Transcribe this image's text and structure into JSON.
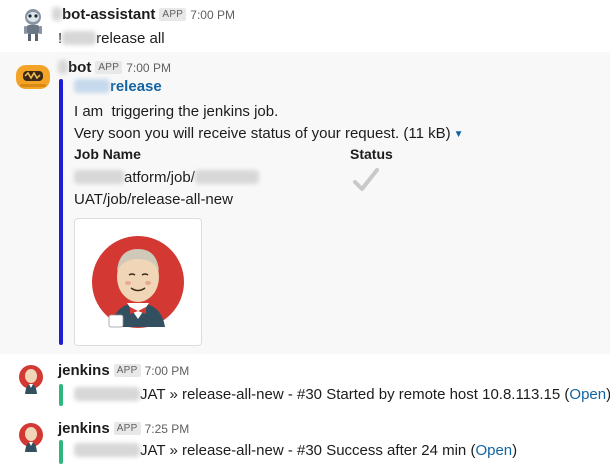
{
  "messages": [
    {
      "sender": "bot-assistant",
      "badge": "APP",
      "time": "7:00 PM",
      "text_prefix": "!",
      "text": "release all"
    },
    {
      "sender": "bot",
      "badge": "APP",
      "time": "7:00 PM",
      "attachment": {
        "title": "release",
        "line1": "I am  triggering the jenkins job.",
        "line2": "Very soon you will receive status of your request.",
        "size": "(11 kB)",
        "col_job": "Job Name",
        "col_status": "Status",
        "job_part1": "atform/job/",
        "job_part2": "UAT/job/release-all-new",
        "status_icon": "check-icon",
        "bar_color": "#1d1dd6"
      }
    },
    {
      "sender": "jenkins",
      "badge": "APP",
      "time": "7:00 PM",
      "text": "JAT » release-all-new - #30 Started by remote host 10.8.113.15",
      "paren_open": "(",
      "link": "Open",
      "paren_close": ")",
      "bar_color": "#2eb67d"
    },
    {
      "sender": "jenkins",
      "badge": "APP",
      "time": "7:25 PM",
      "text": "JAT » release-all-new - #30 Success after 24 min",
      "paren_open": "(",
      "link": "Open",
      "paren_close": ")",
      "bar_color": "#2eb67d"
    }
  ]
}
